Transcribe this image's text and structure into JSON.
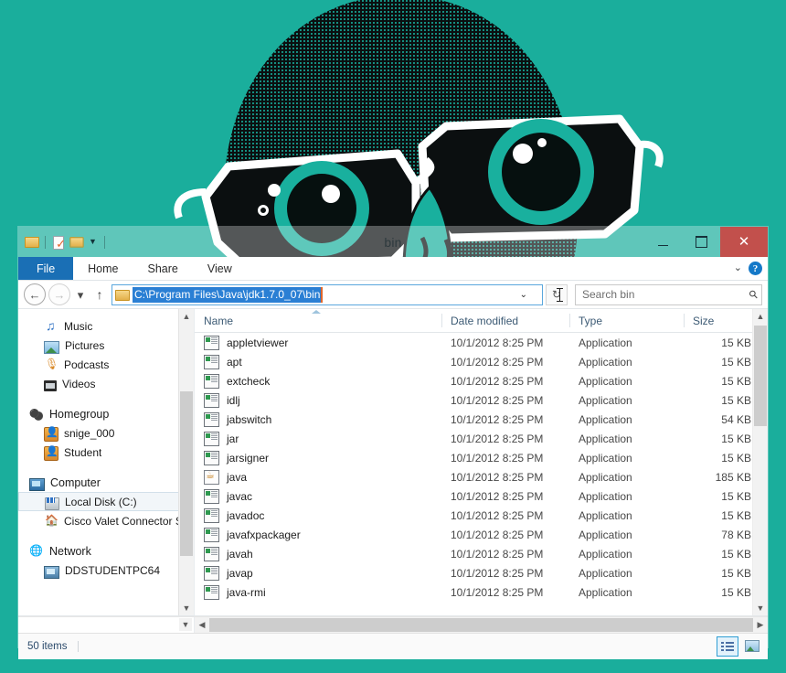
{
  "desktop": {
    "background_color": "#1aae9c",
    "wallpaper": "owl-with-glasses-illustration"
  },
  "window": {
    "title": "bin",
    "quick_access": [
      {
        "name": "folder-icon",
        "label": "Folder"
      },
      {
        "name": "properties-icon",
        "label": "Properties"
      },
      {
        "name": "new-folder-icon",
        "label": "New folder"
      },
      {
        "name": "customize-qat-icon",
        "label": "▼"
      }
    ],
    "controls": {
      "minimize": "─",
      "maximize": "□",
      "close": "✕"
    },
    "close_color": "#c2504c"
  },
  "ribbon": {
    "tabs": [
      {
        "label": "File",
        "active": true
      },
      {
        "label": "Home",
        "active": false
      },
      {
        "label": "Share",
        "active": false
      },
      {
        "label": "View",
        "active": false
      }
    ],
    "expand_label": "⌄",
    "help_label": "?"
  },
  "addressbar": {
    "back_label": "←",
    "forward_label": "→",
    "recent_label": "▾",
    "up_label": "↑",
    "path": "C:\\Program Files\\Java\\jdk1.7.0_07\\bin",
    "dropdown_label": "⌄",
    "refresh_label": "↻",
    "selection_color": "#2a7fd4"
  },
  "search": {
    "placeholder": "Search bin",
    "icon": "search-icon"
  },
  "navpane": {
    "groups": [
      {
        "items": [
          {
            "label": "Music",
            "icon": "music-icon",
            "indent": 1
          },
          {
            "label": "Pictures",
            "icon": "pictures-icon",
            "indent": 1
          },
          {
            "label": "Podcasts",
            "icon": "podcasts-icon",
            "indent": 1
          },
          {
            "label": "Videos",
            "icon": "videos-icon",
            "indent": 1
          }
        ]
      },
      {
        "items": [
          {
            "label": "Homegroup",
            "icon": "homegroup-icon",
            "indent": 0
          },
          {
            "label": "snige_000",
            "icon": "user-icon",
            "indent": 1
          },
          {
            "label": "Student",
            "icon": "user-icon",
            "indent": 1
          }
        ]
      },
      {
        "items": [
          {
            "label": "Computer",
            "icon": "computer-icon",
            "indent": 0
          },
          {
            "label": "Local Disk (C:)",
            "icon": "disk-icon",
            "indent": 1,
            "selected": true
          },
          {
            "label": "Cisco Valet Connector Se",
            "icon": "router-icon",
            "indent": 1
          }
        ]
      },
      {
        "items": [
          {
            "label": "Network",
            "icon": "network-icon",
            "indent": 0
          },
          {
            "label": "DDSTUDENTPC64",
            "icon": "pc-icon",
            "indent": 1
          }
        ]
      }
    ]
  },
  "filelist": {
    "columns": [
      "Name",
      "Date modified",
      "Type",
      "Size"
    ],
    "sort_column": "Name",
    "sort_direction": "ascending",
    "rows": [
      {
        "name": "appletviewer",
        "date": "10/1/2012 8:25 PM",
        "type": "Application",
        "size": "15 KB",
        "icon": "application-icon"
      },
      {
        "name": "apt",
        "date": "10/1/2012 8:25 PM",
        "type": "Application",
        "size": "15 KB",
        "icon": "application-icon"
      },
      {
        "name": "extcheck",
        "date": "10/1/2012 8:25 PM",
        "type": "Application",
        "size": "15 KB",
        "icon": "application-icon"
      },
      {
        "name": "idlj",
        "date": "10/1/2012 8:25 PM",
        "type": "Application",
        "size": "15 KB",
        "icon": "application-icon"
      },
      {
        "name": "jabswitch",
        "date": "10/1/2012 8:25 PM",
        "type": "Application",
        "size": "54 KB",
        "icon": "application-icon"
      },
      {
        "name": "jar",
        "date": "10/1/2012 8:25 PM",
        "type": "Application",
        "size": "15 KB",
        "icon": "application-icon"
      },
      {
        "name": "jarsigner",
        "date": "10/1/2012 8:25 PM",
        "type": "Application",
        "size": "15 KB",
        "icon": "application-icon"
      },
      {
        "name": "java",
        "date": "10/1/2012 8:25 PM",
        "type": "Application",
        "size": "185 KB",
        "icon": "java-icon"
      },
      {
        "name": "javac",
        "date": "10/1/2012 8:25 PM",
        "type": "Application",
        "size": "15 KB",
        "icon": "application-icon"
      },
      {
        "name": "javadoc",
        "date": "10/1/2012 8:25 PM",
        "type": "Application",
        "size": "15 KB",
        "icon": "application-icon"
      },
      {
        "name": "javafxpackager",
        "date": "10/1/2012 8:25 PM",
        "type": "Application",
        "size": "78 KB",
        "icon": "application-icon"
      },
      {
        "name": "javah",
        "date": "10/1/2012 8:25 PM",
        "type": "Application",
        "size": "15 KB",
        "icon": "application-icon"
      },
      {
        "name": "javap",
        "date": "10/1/2012 8:25 PM",
        "type": "Application",
        "size": "15 KB",
        "icon": "application-icon"
      },
      {
        "name": "java-rmi",
        "date": "10/1/2012 8:25 PM",
        "type": "Application",
        "size": "15 KB",
        "icon": "application-icon"
      }
    ]
  },
  "statusbar": {
    "item_count": "50 items",
    "views": [
      {
        "name": "details-view-button",
        "selected": true
      },
      {
        "name": "large-icons-view-button",
        "selected": false
      }
    ]
  }
}
